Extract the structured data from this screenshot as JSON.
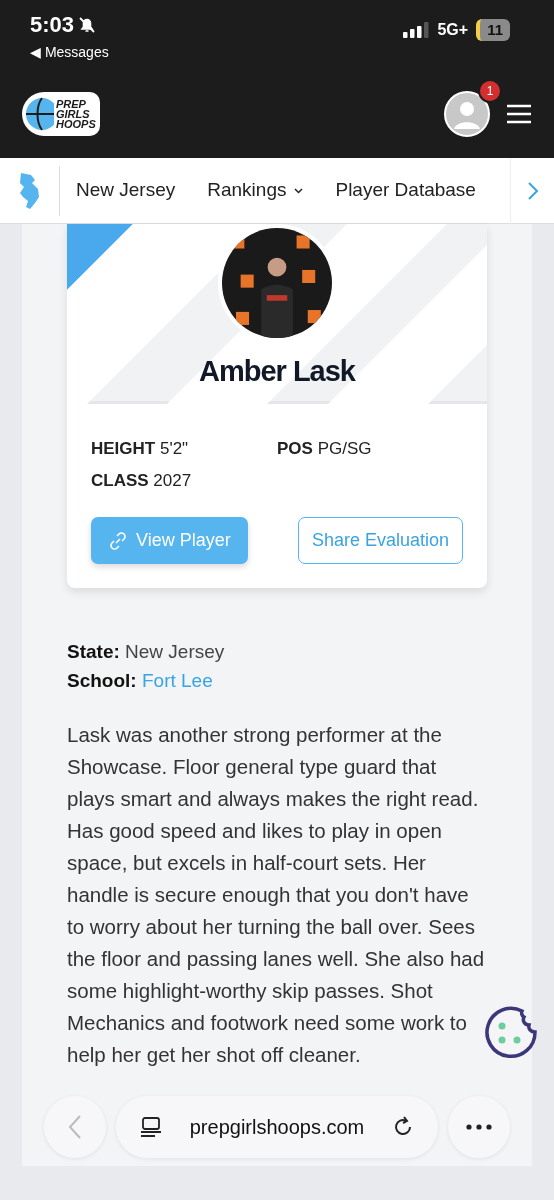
{
  "status_bar": {
    "time": "5:03",
    "back_label": "◀ Messages",
    "network": "5G+",
    "battery": "11"
  },
  "header": {
    "logo_lines": [
      "PREP",
      "GIRLS",
      "HOOPS"
    ],
    "notification_count": "1"
  },
  "nav": {
    "items": [
      {
        "label": "New Jersey",
        "kind": "link"
      },
      {
        "label": "Rankings",
        "kind": "dropdown"
      },
      {
        "label": "Player Database",
        "kind": "link"
      }
    ]
  },
  "player_card": {
    "name": "Amber Lask",
    "stats": [
      {
        "label": "HEIGHT",
        "value": "5'2\""
      },
      {
        "label": "POS",
        "value": "PG/SG"
      },
      {
        "label": "CLASS",
        "value": "2027"
      }
    ],
    "buttons": [
      {
        "label": "View Player",
        "kind": "primary"
      },
      {
        "label": "Share Evaluation",
        "kind": "outline"
      }
    ]
  },
  "details": [
    {
      "label": "State:",
      "value": "New Jersey",
      "kind": "text"
    },
    {
      "label": "School:",
      "value": "Fort Lee",
      "kind": "link"
    }
  ],
  "evaluation": "Lask was another strong performer at the Showcase. Floor general type guard that plays smart and always makes the right read. Has good speed and likes to play in open space, but excels in half-court sets. Her handle is secure enough that you don't have to worry about her turning the ball over. Sees the floor and passing lanes well. She also had some highlight-worthy skip passes. Shot Mechanics and footwork need some work to help her get her shot off cleaner.",
  "browser_bar": {
    "url": "prepgirlshoops.com"
  }
}
